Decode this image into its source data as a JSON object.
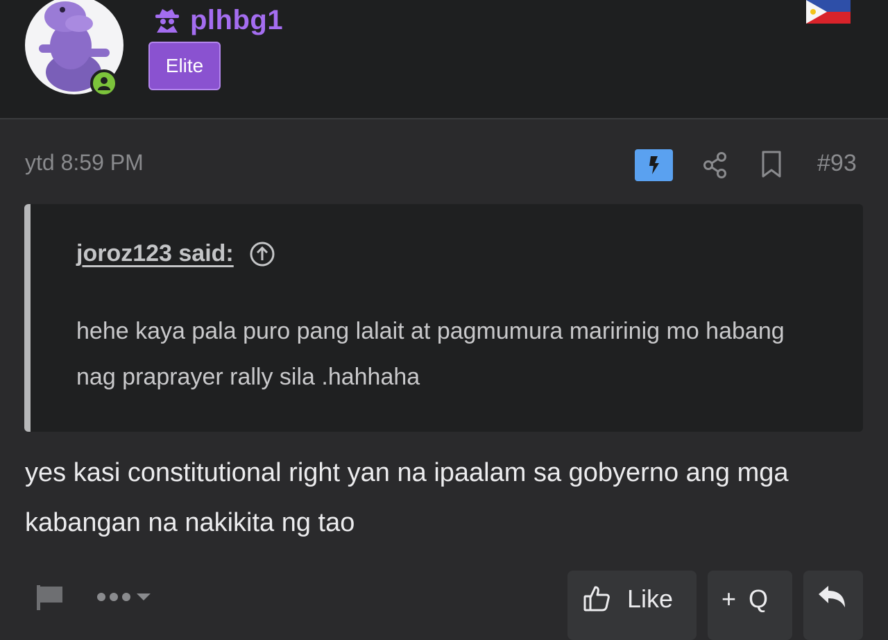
{
  "user": {
    "username": "plhbg1",
    "badge": "Elite",
    "avatar_icon": "purple-hippo-avatar",
    "status_icon": "online-user-icon",
    "flag_icon": "philippines-flag-icon"
  },
  "post": {
    "time": "ytd 8:59 PM",
    "number": "#93",
    "body": "yes kasi constitutional right yan na ipaalam sa gobyerno ang mga kabangan na nakikita ng tao"
  },
  "quote": {
    "author": "joroz123 said:",
    "text": "hehe kaya pala puro pang lalait at pagmumura maririnig mo habang nag praprayer rally sila .hahhaha"
  },
  "actions": {
    "like_label": "Like",
    "quote_plus": "+",
    "quote_label": "Q"
  },
  "colors": {
    "accent_purple": "#a46df0",
    "badge_bg": "#8a52d0",
    "online_green": "#7cc33b",
    "lightning_blue": "#5aa1f0"
  }
}
